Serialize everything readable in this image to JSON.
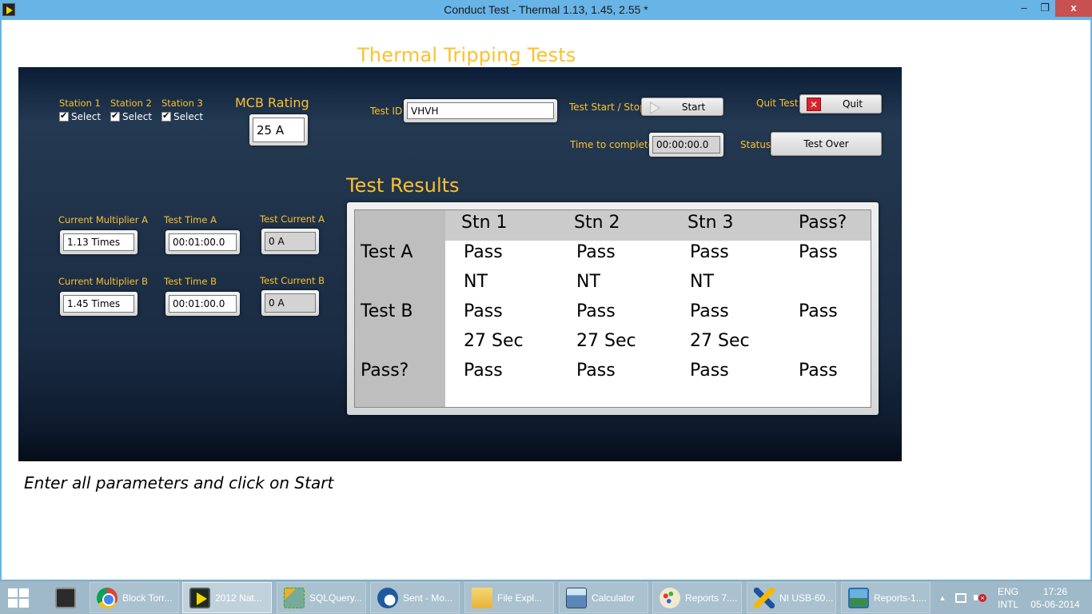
{
  "window": {
    "title": "Conduct Test - Thermal 1.13, 1.45, 2.55 *",
    "icon": "labview-vi-icon",
    "controls": {
      "minimize": "–",
      "maximize": "❐",
      "close": "x"
    }
  },
  "front_panel": {
    "title": "Thermal Tripping Tests",
    "colors": {
      "label": "#fdc02f",
      "panel_background": "#1f3249"
    },
    "stations": [
      {
        "label": "Station 1",
        "checkbox_label": "Select",
        "checked": true
      },
      {
        "label": "Station 2",
        "checkbox_label": "Select",
        "checked": true
      },
      {
        "label": "Station 3",
        "checkbox_label": "Select",
        "checked": true
      }
    ],
    "mcb_rating": {
      "label": "MCB Rating",
      "value": "25 A"
    },
    "test_id": {
      "label": "Test ID",
      "value": "VHVH"
    },
    "start_stop": {
      "label": "Test Start / Stop",
      "button": "Start",
      "icon": "play-icon"
    },
    "quit": {
      "label": "Quit Test",
      "button": "Quit",
      "icon": "close-x-icon"
    },
    "time_to_complete": {
      "label": "Time to complete",
      "value": "00:00:00.0"
    },
    "status": {
      "label": "Status",
      "value": "Test Over"
    },
    "test_a": {
      "multiplier_label": "Current Multiplier A",
      "multiplier_value": "1.13 Times",
      "time_label": "Test Time A",
      "time_value": "00:01:00.0",
      "current_label": "Test Current A",
      "current_value": "0 A"
    },
    "test_b": {
      "multiplier_label": "Current Multiplier B",
      "multiplier_value": "1.45 Times",
      "time_label": "Test Time B",
      "time_value": "00:01:00.0",
      "current_label": "Test Current B",
      "current_value": "0 A"
    },
    "results": {
      "title": "Test Results",
      "columns": [
        "",
        "Stn 1",
        "Stn 2",
        "Stn 3",
        "Pass?"
      ],
      "rows": [
        {
          "header": "Test A",
          "cells": [
            "Pass",
            "Pass",
            "Pass",
            "Pass"
          ]
        },
        {
          "header": "",
          "cells": [
            "NT",
            "NT",
            "NT",
            ""
          ]
        },
        {
          "header": "Test B",
          "cells": [
            "Pass",
            "Pass",
            "Pass",
            "Pass"
          ]
        },
        {
          "header": "",
          "cells": [
            "27 Sec",
            "27 Sec",
            "27 Sec",
            ""
          ]
        },
        {
          "header": "Pass?",
          "cells": [
            "Pass",
            "Pass",
            "Pass",
            "Pass"
          ]
        }
      ]
    },
    "instructions": "Enter all parameters and click on Start"
  },
  "taskbar": {
    "items": [
      {
        "label": "",
        "icon": "console-icon"
      },
      {
        "label": "Block Torr...",
        "icon": "chrome-icon"
      },
      {
        "label": "2012 Nat...",
        "icon": "labview-icon",
        "active": true
      },
      {
        "label": "SQLQuery...",
        "icon": "sql-query-icon"
      },
      {
        "label": "Sent - Mo...",
        "icon": "thunderbird-icon"
      },
      {
        "label": "File Expl...",
        "icon": "folder-icon"
      },
      {
        "label": "Calculator",
        "icon": "calculator-icon"
      },
      {
        "label": "Reports 7....",
        "icon": "paint-icon"
      },
      {
        "label": "NI USB-60...",
        "icon": "ni-max-icon"
      },
      {
        "label": "Reports-1....",
        "icon": "photo-viewer-icon"
      }
    ],
    "tray": {
      "show_hidden": "▲",
      "language_top": "ENG",
      "language_bottom": "INTL",
      "time": "17:26",
      "date": "05-06-2014"
    }
  }
}
